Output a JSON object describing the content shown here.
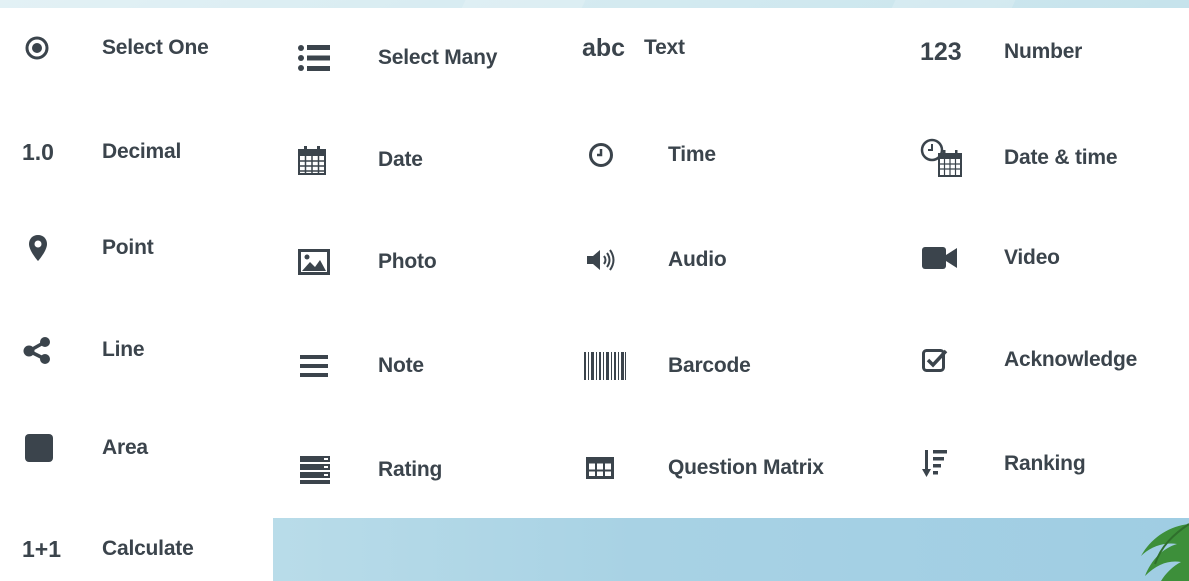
{
  "question_types": [
    {
      "id": "select-one",
      "label": "Select One",
      "icon": "radio-button-icon"
    },
    {
      "id": "select-many",
      "label": "Select Many",
      "icon": "list-icon"
    },
    {
      "id": "text",
      "label": "Text",
      "icon": "abc-text-icon",
      "icon_text": "abc"
    },
    {
      "id": "number",
      "label": "Number",
      "icon": "number-icon",
      "icon_text": "123"
    },
    {
      "id": "decimal",
      "label": "Decimal",
      "icon": "decimal-icon",
      "icon_text": "1.0"
    },
    {
      "id": "date",
      "label": "Date",
      "icon": "calendar-icon"
    },
    {
      "id": "time",
      "label": "Time",
      "icon": "clock-icon"
    },
    {
      "id": "date-time",
      "label": "Date & time",
      "icon": "clock-calendar-icon"
    },
    {
      "id": "point",
      "label": "Point",
      "icon": "map-pin-icon"
    },
    {
      "id": "photo",
      "label": "Photo",
      "icon": "image-icon"
    },
    {
      "id": "audio",
      "label": "Audio",
      "icon": "speaker-icon"
    },
    {
      "id": "video",
      "label": "Video",
      "icon": "video-camera-icon"
    },
    {
      "id": "line",
      "label": "Line",
      "icon": "share-nodes-icon"
    },
    {
      "id": "note",
      "label": "Note",
      "icon": "menu-lines-icon"
    },
    {
      "id": "barcode",
      "label": "Barcode",
      "icon": "barcode-icon"
    },
    {
      "id": "acknowledge",
      "label": "Acknowledge",
      "icon": "checkbox-checked-icon"
    },
    {
      "id": "area",
      "label": "Area",
      "icon": "square-icon"
    },
    {
      "id": "rating",
      "label": "Rating",
      "icon": "stacked-bars-icon"
    },
    {
      "id": "question-matrix",
      "label": "Question Matrix",
      "icon": "table-grid-icon"
    },
    {
      "id": "ranking",
      "label": "Ranking",
      "icon": "sort-down-icon"
    },
    {
      "id": "calculate",
      "label": "Calculate",
      "icon": "calculate-icon",
      "icon_text": "1+1"
    }
  ],
  "colors": {
    "icon": "#3b444c",
    "label": "#3b444c",
    "panel": "#ffffff"
  }
}
